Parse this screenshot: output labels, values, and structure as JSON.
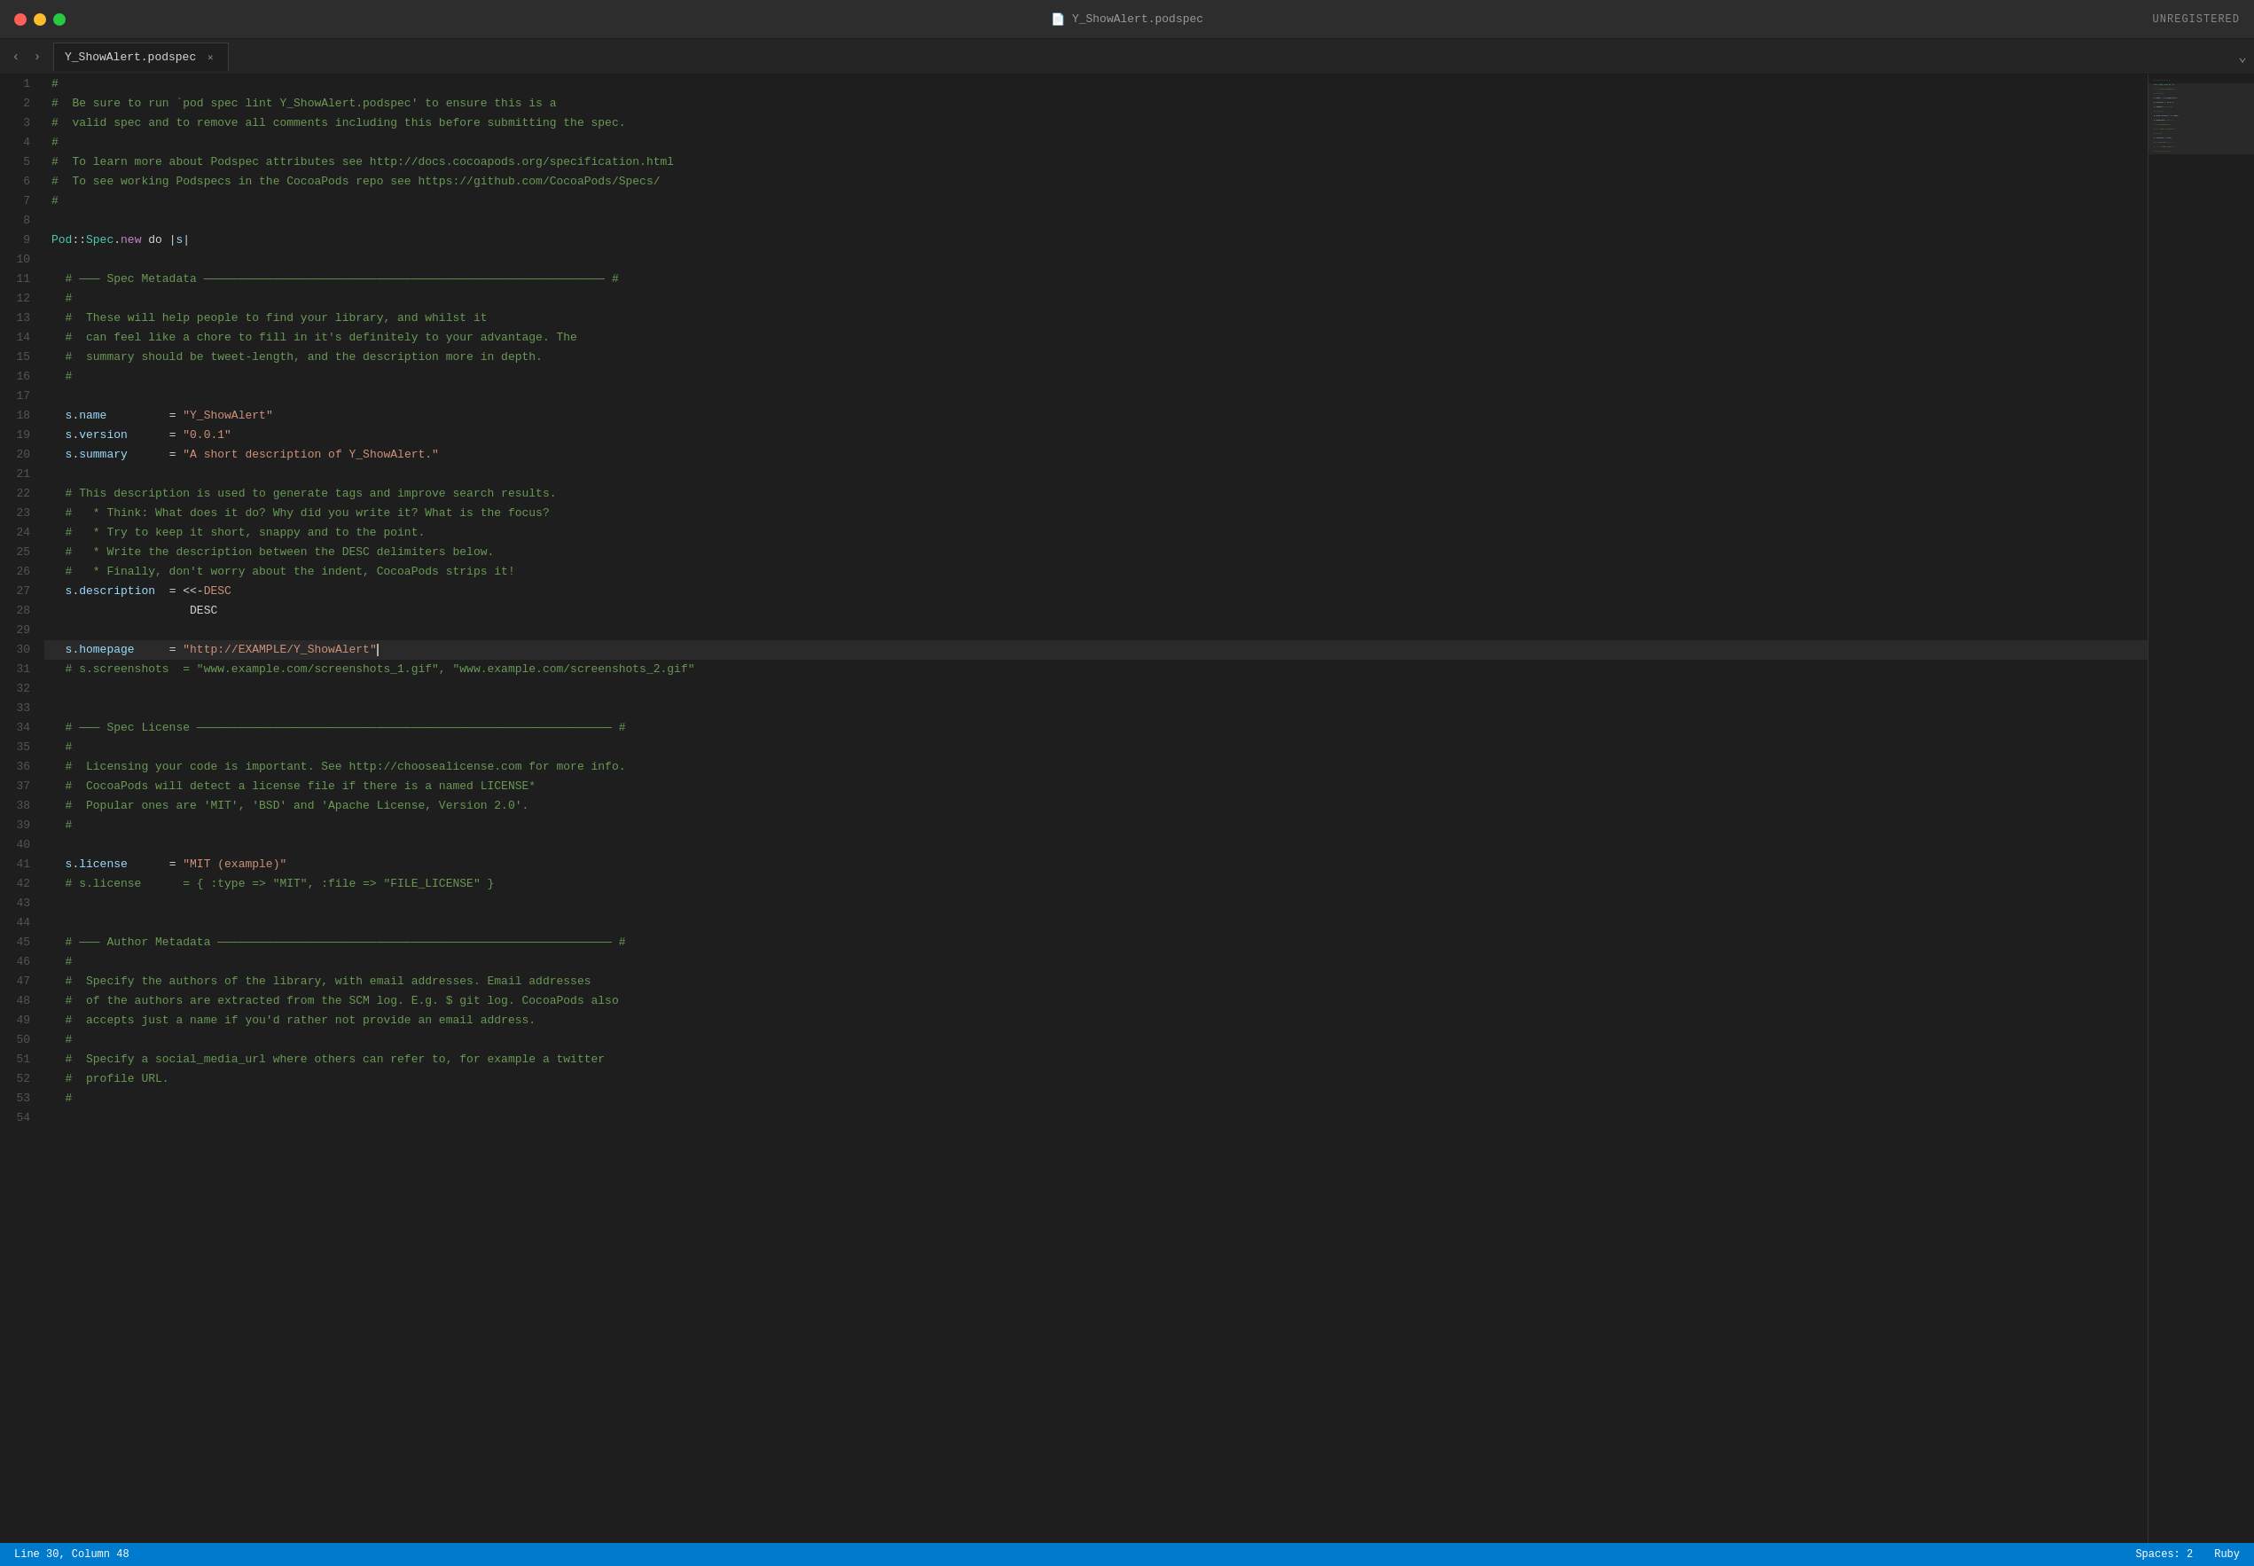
{
  "titleBar": {
    "filename": "Y_ShowAlert.podspec",
    "unregistered": "UNREGISTERED",
    "fileIcon": "📄"
  },
  "tabs": [
    {
      "label": "Y_ShowAlert.podspec",
      "active": true,
      "closable": true
    }
  ],
  "editor": {
    "activeLineNumber": 30,
    "cursorColumn": 48,
    "spacesSize": 2,
    "language": "Ruby"
  },
  "statusBar": {
    "position": "Line 30, Column 48",
    "spaces": "Spaces: 2",
    "language": "Ruby"
  },
  "navArrows": {
    "back": "‹",
    "forward": "›"
  }
}
